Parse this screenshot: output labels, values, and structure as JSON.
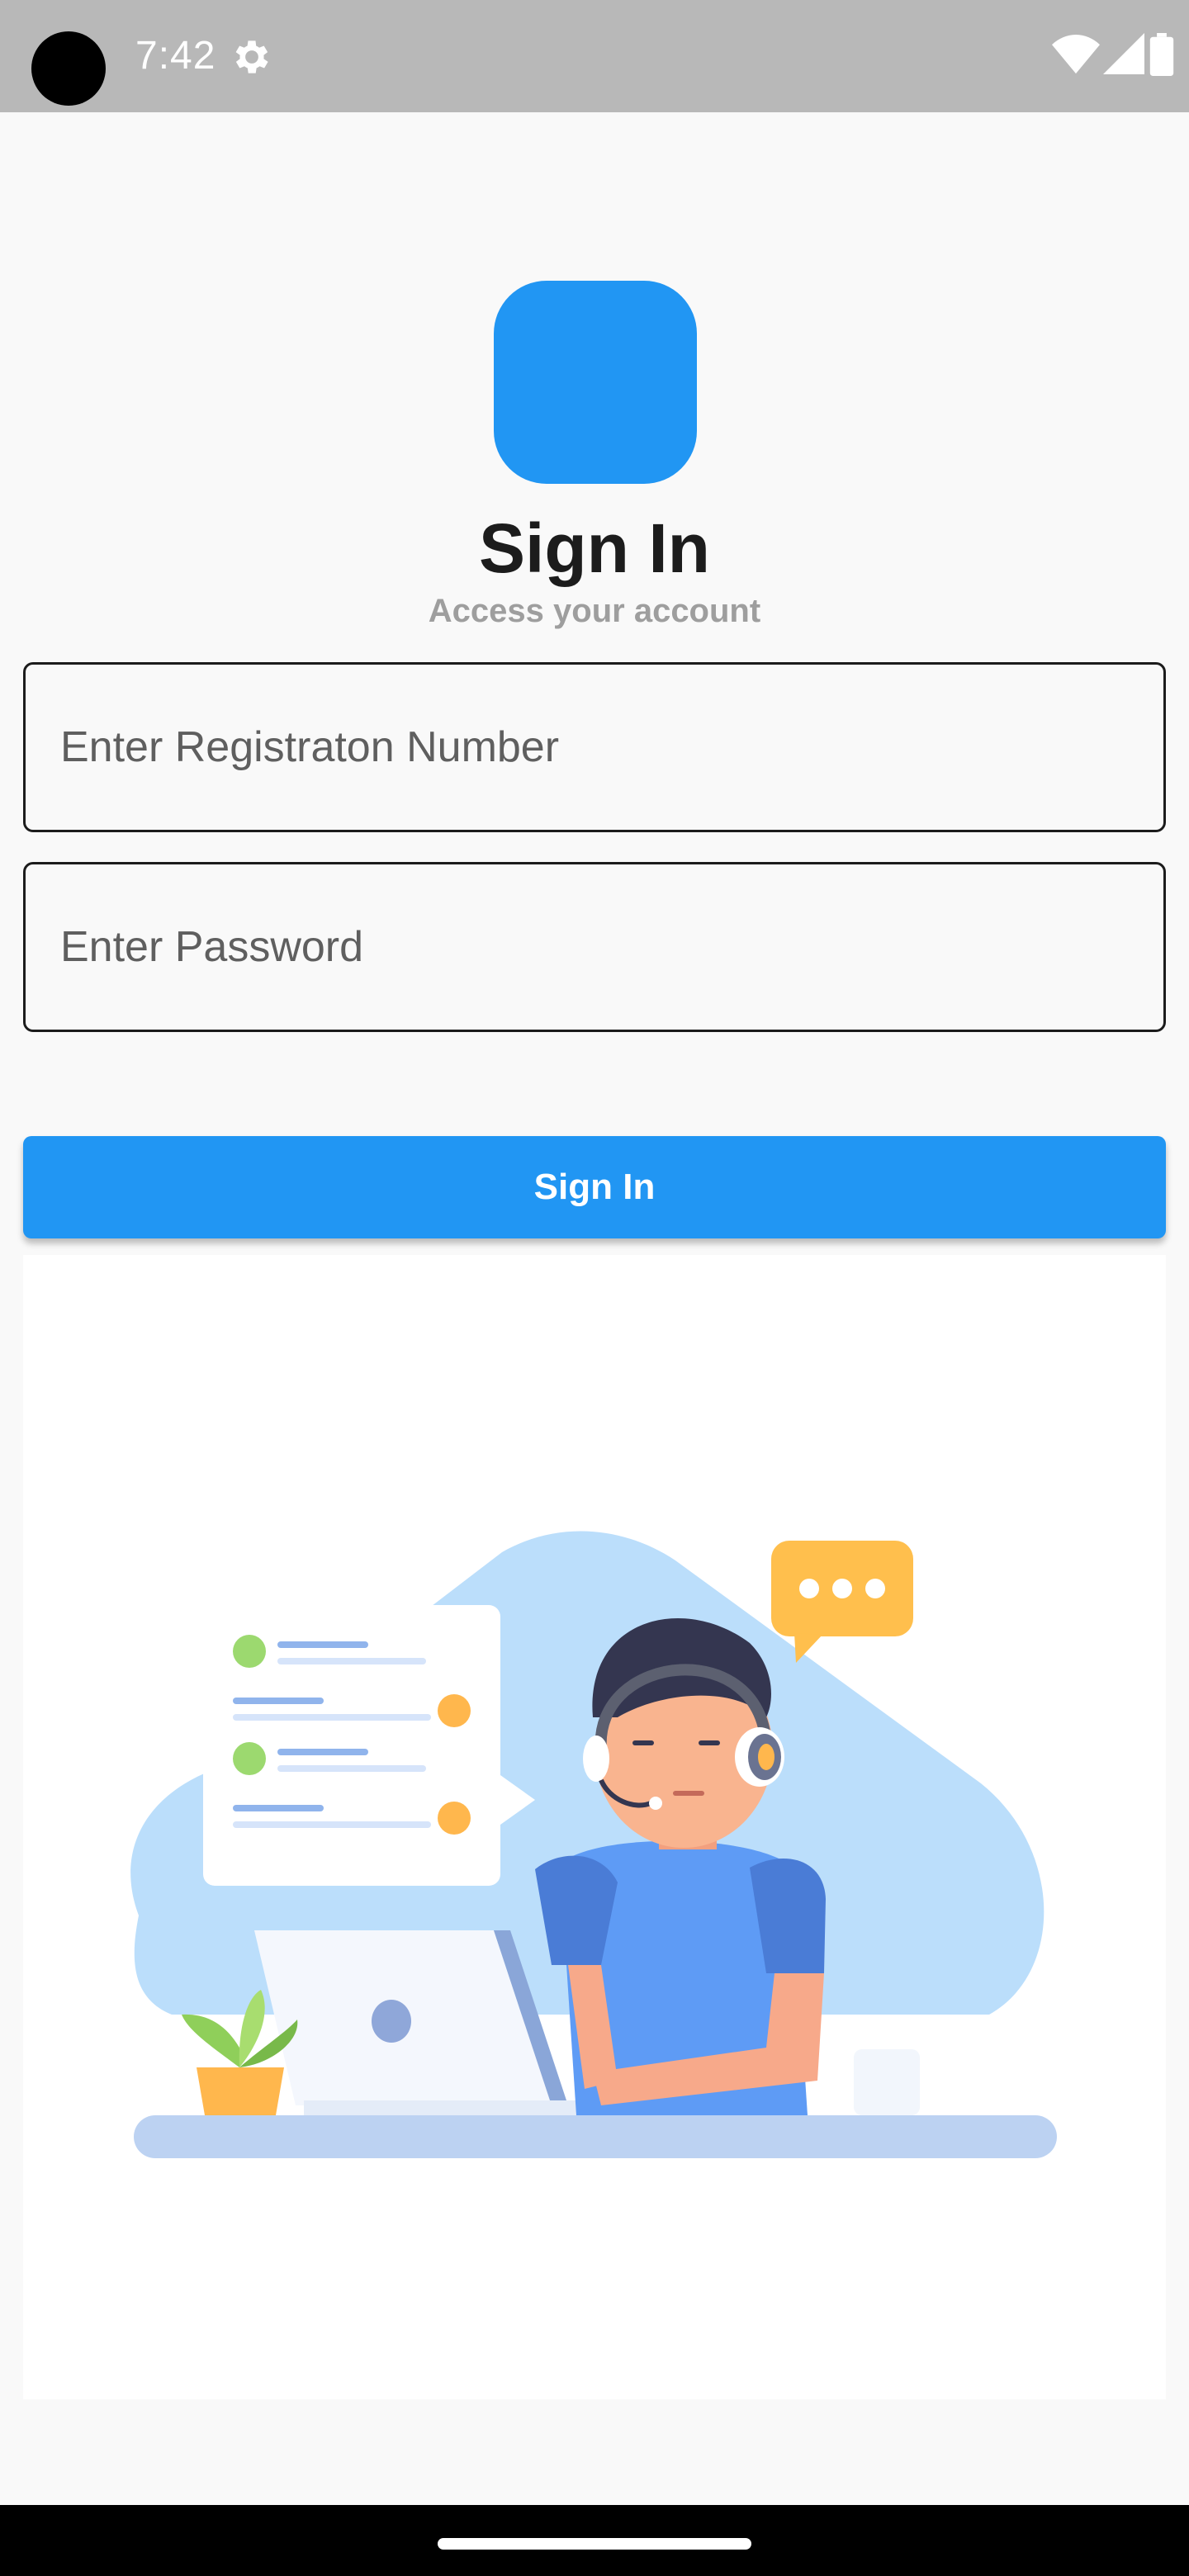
{
  "status_bar": {
    "time": "7:42",
    "icons": [
      "settings-gear-icon",
      "wifi-icon",
      "cellular-signal-icon",
      "battery-icon"
    ]
  },
  "app": {
    "logo_color": "#2196f3",
    "title": "Sign In",
    "subtitle": "Access your account"
  },
  "form": {
    "registration_placeholder": "Enter Registraton Number",
    "password_placeholder": "Enter Password",
    "submit_label": "Sign In"
  },
  "illustration": {
    "subject": "customer-support-agent-illustration"
  },
  "colors": {
    "accent": "#2196f3",
    "background": "#f9f9f9",
    "status_bar": "#b8b8b8"
  }
}
